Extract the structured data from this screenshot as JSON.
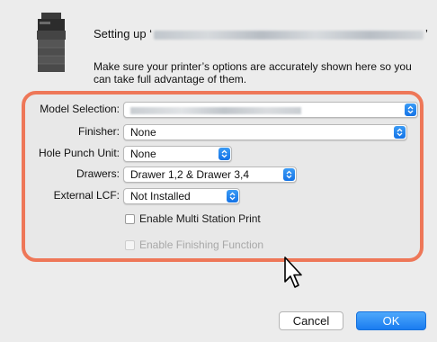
{
  "header": {
    "title_prefix": "Setting up ‘",
    "title_suffix": "’",
    "description": "Make sure your printer’s options are accurately shown here so you can take full advantage of them."
  },
  "options": {
    "model_selection": {
      "label": "Model Selection:"
    },
    "finisher": {
      "label": "Finisher:",
      "value": "None"
    },
    "hole_punch": {
      "label": "Hole Punch Unit:",
      "value": "None"
    },
    "drawers": {
      "label": "Drawers:",
      "value": "Drawer 1,2 & Drawer 3,4"
    },
    "external_lcf": {
      "label": "External LCF:",
      "value": "Not Installed"
    },
    "multi_station": {
      "label": "Enable Multi Station Print",
      "checked": false
    },
    "finishing_function": {
      "label": "Enable Finishing Function",
      "checked": false,
      "enabled": false
    }
  },
  "buttons": {
    "cancel": "Cancel",
    "ok": "OK"
  },
  "colors": {
    "highlight": "#ee7758",
    "accent": "#1a7cf0"
  }
}
